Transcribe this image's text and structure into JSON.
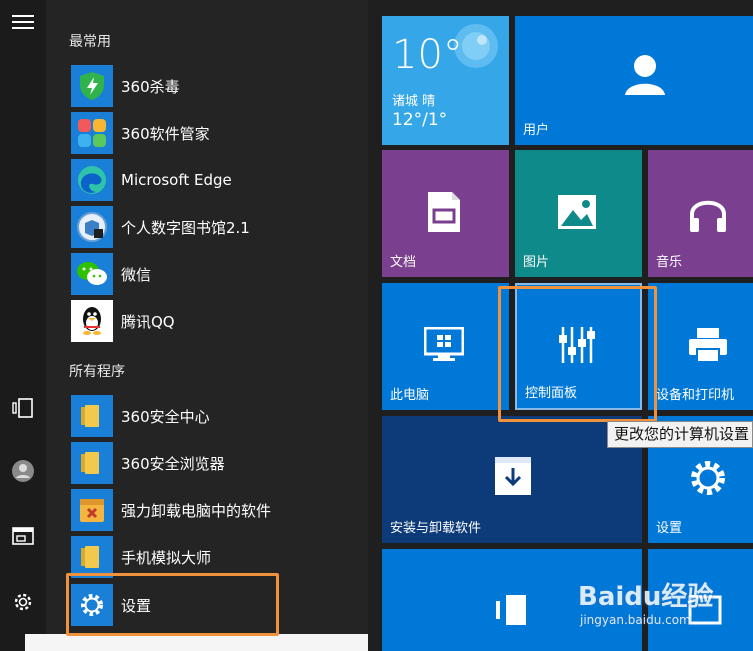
{
  "sections": {
    "frequent": "最常用",
    "all_programs": "所有程序"
  },
  "frequent_apps": [
    {
      "label": "360杀毒",
      "icon": "360-antivirus-icon"
    },
    {
      "label": "360软件管家",
      "icon": "360-software-manager-icon"
    },
    {
      "label": "Microsoft Edge",
      "icon": "edge-icon"
    },
    {
      "label": "个人数字图书馆2.1",
      "icon": "digital-library-icon"
    },
    {
      "label": "微信",
      "icon": "wechat-icon"
    },
    {
      "label": "腾讯QQ",
      "icon": "qq-penguin-icon"
    }
  ],
  "all_apps": [
    {
      "label": "360安全中心",
      "icon": "folder-icon"
    },
    {
      "label": "360安全浏览器",
      "icon": "folder-icon"
    },
    {
      "label": "强力卸载电脑中的软件",
      "icon": "uninstaller-icon"
    },
    {
      "label": "手机模拟大师",
      "icon": "folder-icon"
    },
    {
      "label": "设置",
      "icon": "gear-icon"
    }
  ],
  "weather": {
    "temp": "10°",
    "city": "诸城 晴",
    "range": "12°/1°"
  },
  "tiles": {
    "user": "用户",
    "documents": "文档",
    "pictures": "图片",
    "music": "音乐",
    "this_pc": "此电脑",
    "control_panel": "控制面板",
    "devices_printers": "设备和打印机",
    "install_uninstall": "安装与卸载软件",
    "settings": "设置"
  },
  "tooltip": "更改您的计算机设置",
  "watermark": {
    "brand": "Baidu经验",
    "url": "jingyan.baidu.com"
  },
  "colors": {
    "accent": "#0078d7",
    "highlight": "#f0913c",
    "weather": "#35a7e8",
    "purple": "#7b3f8f"
  }
}
